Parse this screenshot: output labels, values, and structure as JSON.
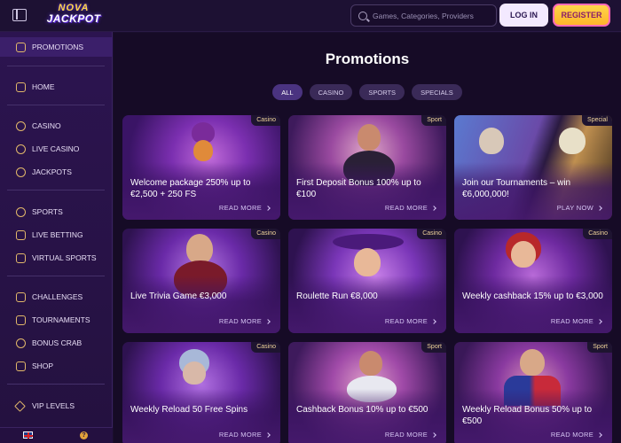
{
  "header": {
    "logo_line1": "NOVA",
    "logo_line2": "JACKPOT",
    "search_placeholder": "Games, Categories, Providers",
    "login_label": "LOG IN",
    "register_label": "REGISTER"
  },
  "sidebar": {
    "items": [
      {
        "label": "PROMOTIONS",
        "icon": "gift-icon",
        "active": true
      },
      {
        "label": "HOME",
        "icon": "home-icon"
      },
      {
        "label": "CASINO",
        "icon": "chip-icon"
      },
      {
        "label": "LIVE CASINO",
        "icon": "live-icon"
      },
      {
        "label": "JACKPOTS",
        "icon": "jackpot-icon"
      },
      {
        "label": "SPORTS",
        "icon": "ball-icon"
      },
      {
        "label": "LIVE BETTING",
        "icon": "live-betting-icon"
      },
      {
        "label": "VIRTUAL SPORTS",
        "icon": "gamepad-icon"
      },
      {
        "label": "CHALLENGES",
        "icon": "challenge-icon"
      },
      {
        "label": "TOURNAMENTS",
        "icon": "trophy-icon"
      },
      {
        "label": "BONUS CRAB",
        "icon": "crab-icon"
      },
      {
        "label": "SHOP",
        "icon": "shop-icon"
      },
      {
        "label": "VIP LEVELS",
        "icon": "diamond-icon"
      }
    ],
    "help_glyph": "?"
  },
  "main": {
    "title": "Promotions",
    "filters": [
      "ALL",
      "CASINO",
      "SPORTS",
      "SPECIALS"
    ],
    "active_filter": "ALL",
    "cards": [
      {
        "tag": "Casino",
        "title": "Welcome package 250% up to €2,500 + 250 FS",
        "link": "READ MORE"
      },
      {
        "tag": "Sport",
        "title": "First Deposit Bonus 100% up to €100",
        "link": "READ MORE"
      },
      {
        "tag": "Special",
        "title": "Join our Tournaments – win €6,000,000!",
        "link": "PLAY NOW"
      },
      {
        "tag": "Casino",
        "title": "Live Trivia Game €3,000",
        "link": "READ MORE"
      },
      {
        "tag": "Casino",
        "title": "Roulette Run €8,000",
        "link": "READ MORE"
      },
      {
        "tag": "Casino",
        "title": "Weekly cashback 15% up to €3,000",
        "link": "READ MORE"
      },
      {
        "tag": "Casino",
        "title": "Weekly Reload 50 Free Spins",
        "link": "READ MORE"
      },
      {
        "tag": "Sport",
        "title": "Cashback Bonus 10% up to €500",
        "link": "READ MORE"
      },
      {
        "tag": "Sport",
        "title": "Weekly Reload Bonus 50% up to €500",
        "link": "READ MORE"
      }
    ]
  },
  "colors": {
    "background": "#160b26",
    "sidebar": "#2c1450",
    "accent_gold": "#ffc53a",
    "register_border": "#ff6ab8"
  }
}
